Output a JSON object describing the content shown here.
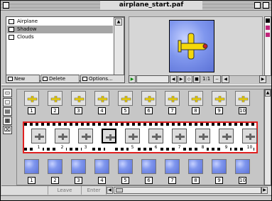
{
  "window": {
    "title": "airplane_start.paf"
  },
  "layers": [
    {
      "name": "Airplane",
      "selected": false
    },
    {
      "name": "Shadow",
      "selected": true
    },
    {
      "name": "Clouds",
      "selected": false
    }
  ],
  "layer_buttons": {
    "new": "New",
    "delete": "Delete",
    "options": "Options..."
  },
  "preview": {
    "zoom": "1:1"
  },
  "rows": {
    "airplane_numbers": [
      "1",
      "2",
      "3",
      "4",
      "5",
      "6",
      "7",
      "8",
      "9",
      "10"
    ],
    "shadow_numbers": [
      "1",
      "2",
      "3",
      "4",
      "5",
      "6",
      "7",
      "8",
      "9",
      "10"
    ],
    "clouds_numbers": [
      "1",
      "2",
      "3",
      "4",
      "5",
      "6",
      "7",
      "8",
      "9",
      "10"
    ],
    "current_frame": "4"
  },
  "status": {
    "leave": "Leave",
    "enter": "Enter"
  },
  "colors": {
    "selection": "#a5a5a5",
    "film_border": "#e02020",
    "sky": "#6e86e6"
  }
}
